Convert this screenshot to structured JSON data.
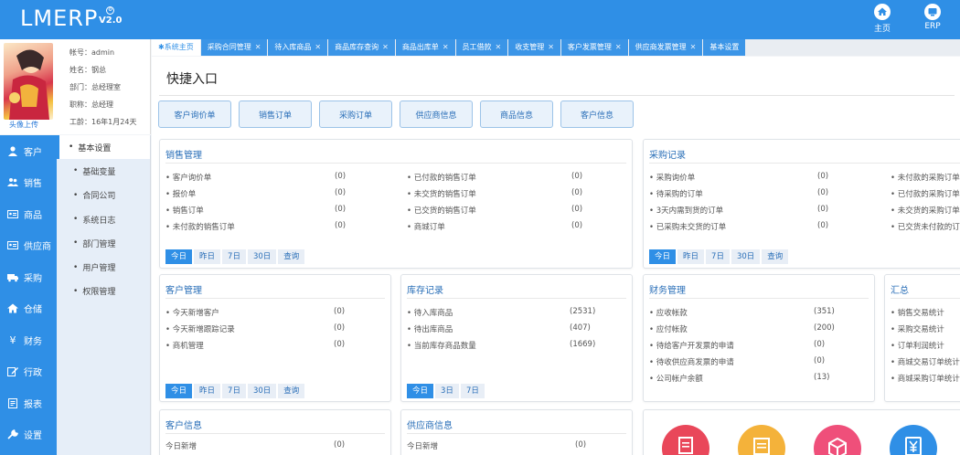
{
  "app": {
    "logo": "LMERP",
    "version": "V2.0"
  },
  "header_buttons": [
    {
      "label": "主页",
      "icon": "home-icon"
    },
    {
      "label": "ERP",
      "icon": "erp-icon"
    }
  ],
  "user": {
    "avatar_link": "头像上传",
    "account": "帐号：admin",
    "name": "姓名：钢总",
    "dept": "部门：总经理室",
    "title": "职称：总经理",
    "tenure": "工龄：16年1月24天"
  },
  "nav": [
    {
      "label": "客户",
      "icon": "user-icon"
    },
    {
      "label": "销售",
      "icon": "users-icon"
    },
    {
      "label": "商品",
      "icon": "id-card-icon"
    },
    {
      "label": "供应商",
      "icon": "id-card-icon"
    },
    {
      "label": "采购",
      "icon": "truck-icon"
    },
    {
      "label": "仓储",
      "icon": "home-icon"
    },
    {
      "label": "财务",
      "icon": "yen-icon"
    },
    {
      "label": "行政",
      "icon": "edit-icon"
    },
    {
      "label": "报表",
      "icon": "report-icon"
    },
    {
      "label": "设置",
      "icon": "wrench-icon"
    }
  ],
  "subnav": [
    {
      "label": "基本设置",
      "active": true
    },
    {
      "label": "基础变量"
    },
    {
      "label": "合同公司"
    },
    {
      "label": "系统日志"
    },
    {
      "label": "部门管理"
    },
    {
      "label": "用户管理"
    },
    {
      "label": "权限管理"
    }
  ],
  "tabs": [
    "系统主页",
    "采购合同管理",
    "待入库商品",
    "商品库存查询",
    "商品出库单",
    "员工借款",
    "收支管理",
    "客户发票管理",
    "供应商发票管理",
    "基本设置"
  ],
  "quick": {
    "title": "快捷入口",
    "buttons": [
      "客户询价单",
      "销售订单",
      "采购订单",
      "供应商信息",
      "商品信息",
      "客户信息"
    ]
  },
  "cards": {
    "sales": {
      "title": "销售管理",
      "left": [
        [
          "客户询价单",
          "(0)"
        ],
        [
          "报价单",
          "(0)"
        ],
        [
          "销售订单",
          "(0)"
        ],
        [
          "未付款的销售订单",
          "(0)"
        ]
      ],
      "right": [
        [
          "已付款的销售订单",
          "(0)"
        ],
        [
          "未交货的销售订单",
          "(0)"
        ],
        [
          "已交货的销售订单",
          "(0)"
        ],
        [
          "商城订单",
          "(0)"
        ]
      ],
      "filters": [
        "今日",
        "昨日",
        "7日",
        "30日",
        "查询"
      ]
    },
    "purchase": {
      "title": "采购记录",
      "left": [
        [
          "采购询价单",
          "(0)"
        ],
        [
          "待采购的订单",
          "(0)"
        ],
        [
          "3天内需到货的订单",
          "(0)"
        ],
        [
          "已采购未交货的订单",
          "(0)"
        ]
      ],
      "right": [
        "未付款的采购订单",
        "已付款的采购订单",
        "未交货的采购订单",
        "已交货未付款的订"
      ],
      "filters": [
        "今日",
        "昨日",
        "7日",
        "30日",
        "查询"
      ]
    },
    "customer": {
      "title": "客户管理",
      "rows": [
        [
          "今天新增客户",
          "(0)"
        ],
        [
          "今天新增跟踪记录",
          "(0)"
        ],
        [
          "商机管理",
          "(0)"
        ]
      ],
      "filters": [
        "今日",
        "昨日",
        "7日",
        "30日",
        "查询"
      ]
    },
    "stock": {
      "title": "库存记录",
      "rows": [
        [
          "待入库商品",
          "(2531)"
        ],
        [
          "待出库商品",
          "(407)"
        ],
        [
          "当前库存商品数量",
          "(1669)"
        ]
      ],
      "filters": [
        "今日",
        "3日",
        "7日"
      ]
    },
    "finance": {
      "title": "财务管理",
      "rows": [
        [
          "应收帐款",
          "(351)"
        ],
        [
          "应付帐款",
          "(200)"
        ],
        [
          "待给客户开发票的申请",
          "(0)"
        ],
        [
          "待收供应商发票的申请",
          "(0)"
        ],
        [
          "公司帐户余额",
          "(13)"
        ]
      ]
    },
    "summary": {
      "title": "汇总",
      "rows": [
        "销售交易统计",
        "采购交易统计",
        "订单利润统计",
        "商城交易订单统计",
        "商城采购订单统计"
      ]
    },
    "custinfo": {
      "title": "客户信息",
      "rows": [
        [
          "今日新增",
          "(0)"
        ]
      ]
    },
    "suppinfo": {
      "title": "供应商信息",
      "rows": [
        [
          "今日新增",
          "(0)"
        ]
      ]
    }
  },
  "circle_colors": [
    "#e9475a",
    "#f4b23a",
    "#ef4f7a",
    "#2f8fe6"
  ]
}
